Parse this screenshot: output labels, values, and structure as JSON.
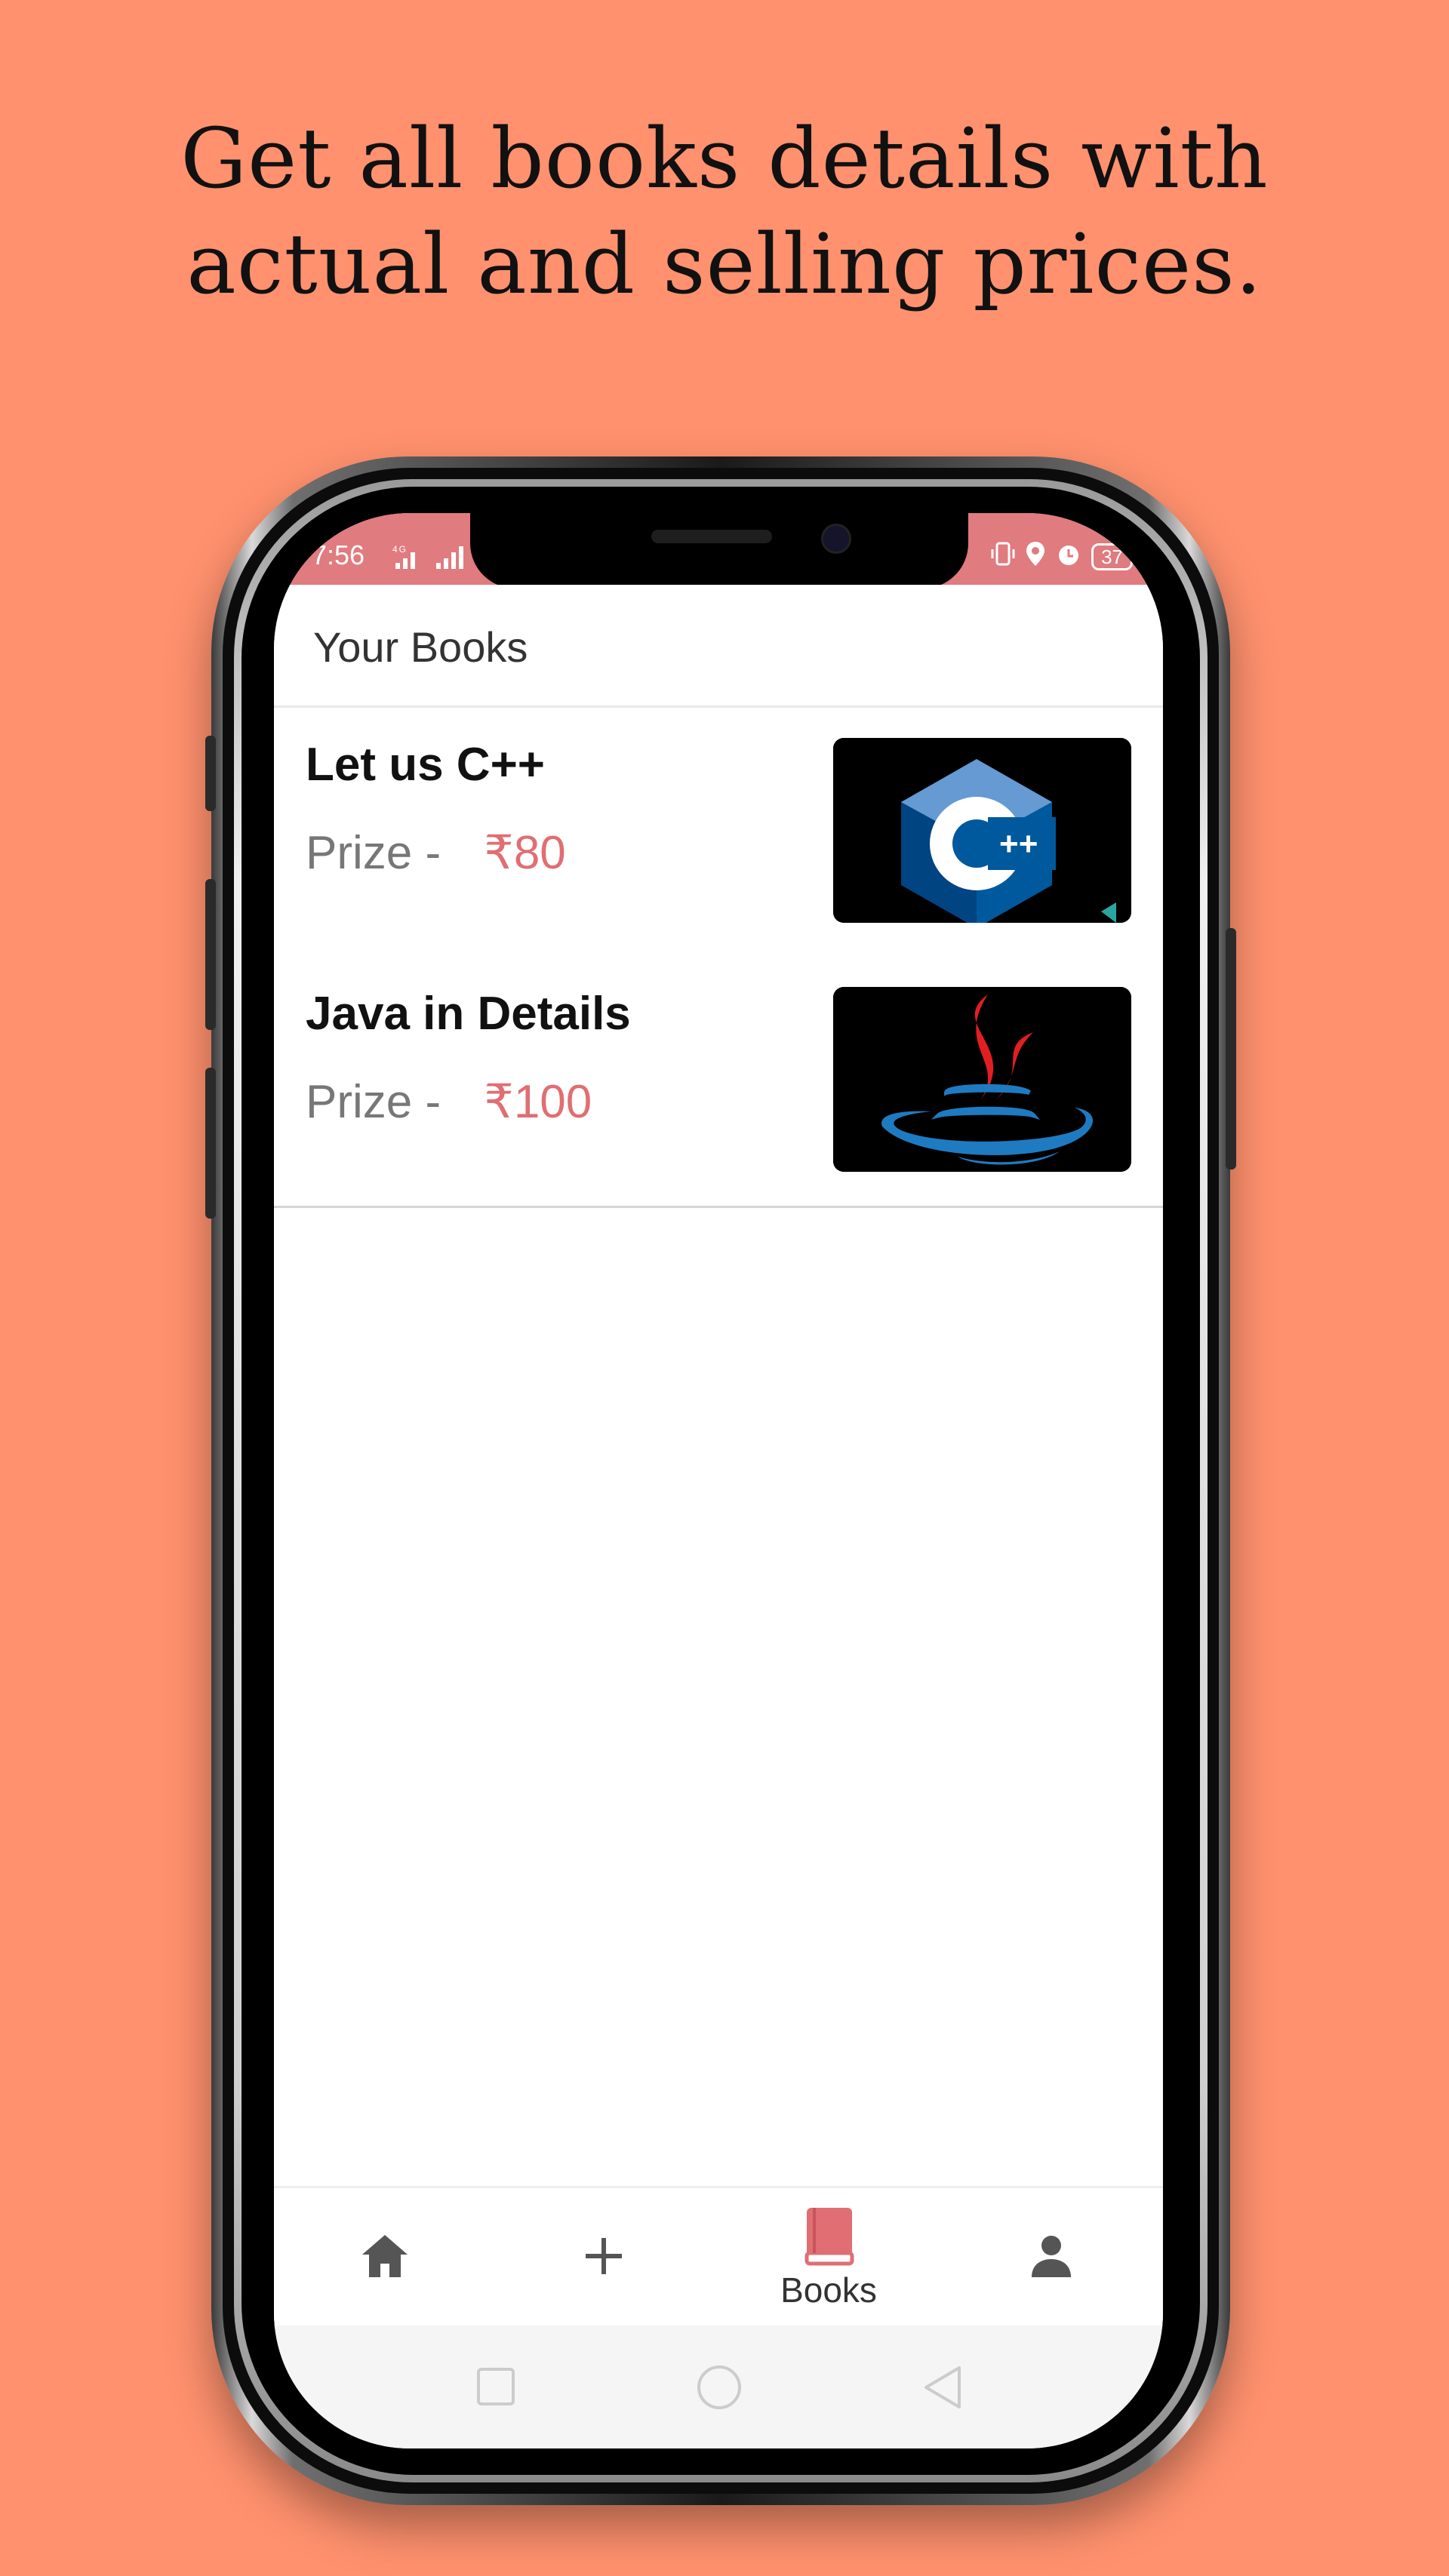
{
  "headline": {
    "line1": "Get all books details with",
    "line2": "actual and selling prices."
  },
  "status_bar": {
    "time": "7:56",
    "network": "4G",
    "battery": "37"
  },
  "app": {
    "title": "Your Books",
    "accent_color": "#E06E72"
  },
  "books": [
    {
      "title": "Let us C++",
      "prize_label": "Prize -",
      "price": "₹80",
      "cover_icon": "cpp-logo-icon"
    },
    {
      "title": "Java in Details",
      "prize_label": "Prize -",
      "price": "₹100",
      "cover_icon": "java-logo-icon"
    }
  ],
  "bottom_nav": {
    "items": [
      {
        "icon": "home-icon",
        "label": ""
      },
      {
        "icon": "plus-icon",
        "label": ""
      },
      {
        "icon": "book-icon",
        "label": "Books",
        "active": true
      },
      {
        "icon": "person-icon",
        "label": ""
      }
    ]
  },
  "system_nav": {
    "items": [
      "recent-apps-icon",
      "home-circle-icon",
      "back-icon"
    ]
  }
}
